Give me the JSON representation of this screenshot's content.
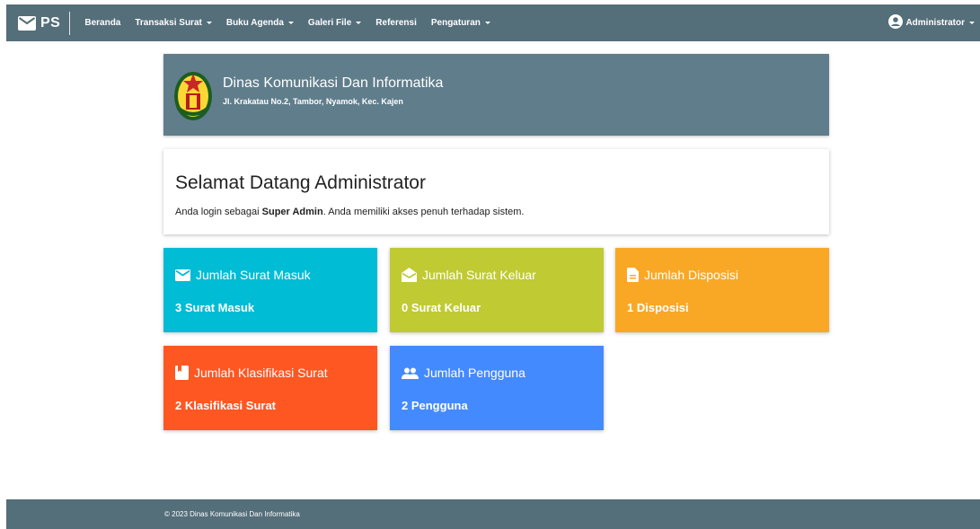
{
  "navbar": {
    "brand": "PS",
    "brand_icon": "mail-icon",
    "items": [
      {
        "label": "Beranda",
        "dropdown": false
      },
      {
        "label": "Transaksi Surat",
        "dropdown": true
      },
      {
        "label": "Buku Agenda",
        "dropdown": true
      },
      {
        "label": "Galeri File",
        "dropdown": true
      },
      {
        "label": "Referensi",
        "dropdown": false
      },
      {
        "label": "Pengaturan",
        "dropdown": true
      }
    ],
    "user": "Administrator",
    "user_icon": "account-circle-icon"
  },
  "header": {
    "org_name": "Dinas Komunikasi Dan Informatika",
    "address": "Jl. Krakatau No.2, Tambor, Nyamok, Kec. Kajen"
  },
  "welcome": {
    "title": "Selamat Datang Administrator",
    "text_prefix": "Anda login sebagai ",
    "role": "Super Admin",
    "text_suffix": ". Anda memiliki akses penuh terhadap sistem."
  },
  "stats": [
    {
      "title": "Jumlah Surat Masuk",
      "value": "3 Surat Masuk",
      "icon": "mail-icon",
      "color": "#00bcd4"
    },
    {
      "title": "Jumlah Surat Keluar",
      "value": "0 Surat Keluar",
      "icon": "drafts-icon",
      "color": "#c0ca33"
    },
    {
      "title": "Jumlah Disposisi",
      "value": "1 Disposisi",
      "icon": "description-icon",
      "color": "#f9a825"
    },
    {
      "title": "Jumlah Klasifikasi Surat",
      "value": "2 Klasifikasi Surat",
      "icon": "bookmark-icon",
      "color": "#ff5722"
    },
    {
      "title": "Jumlah Pengguna",
      "value": "2 Pengguna",
      "icon": "people-icon",
      "color": "#448aff"
    }
  ],
  "footer": {
    "text": "© 2023 Dinas Komunikasi Dan Informatika"
  }
}
